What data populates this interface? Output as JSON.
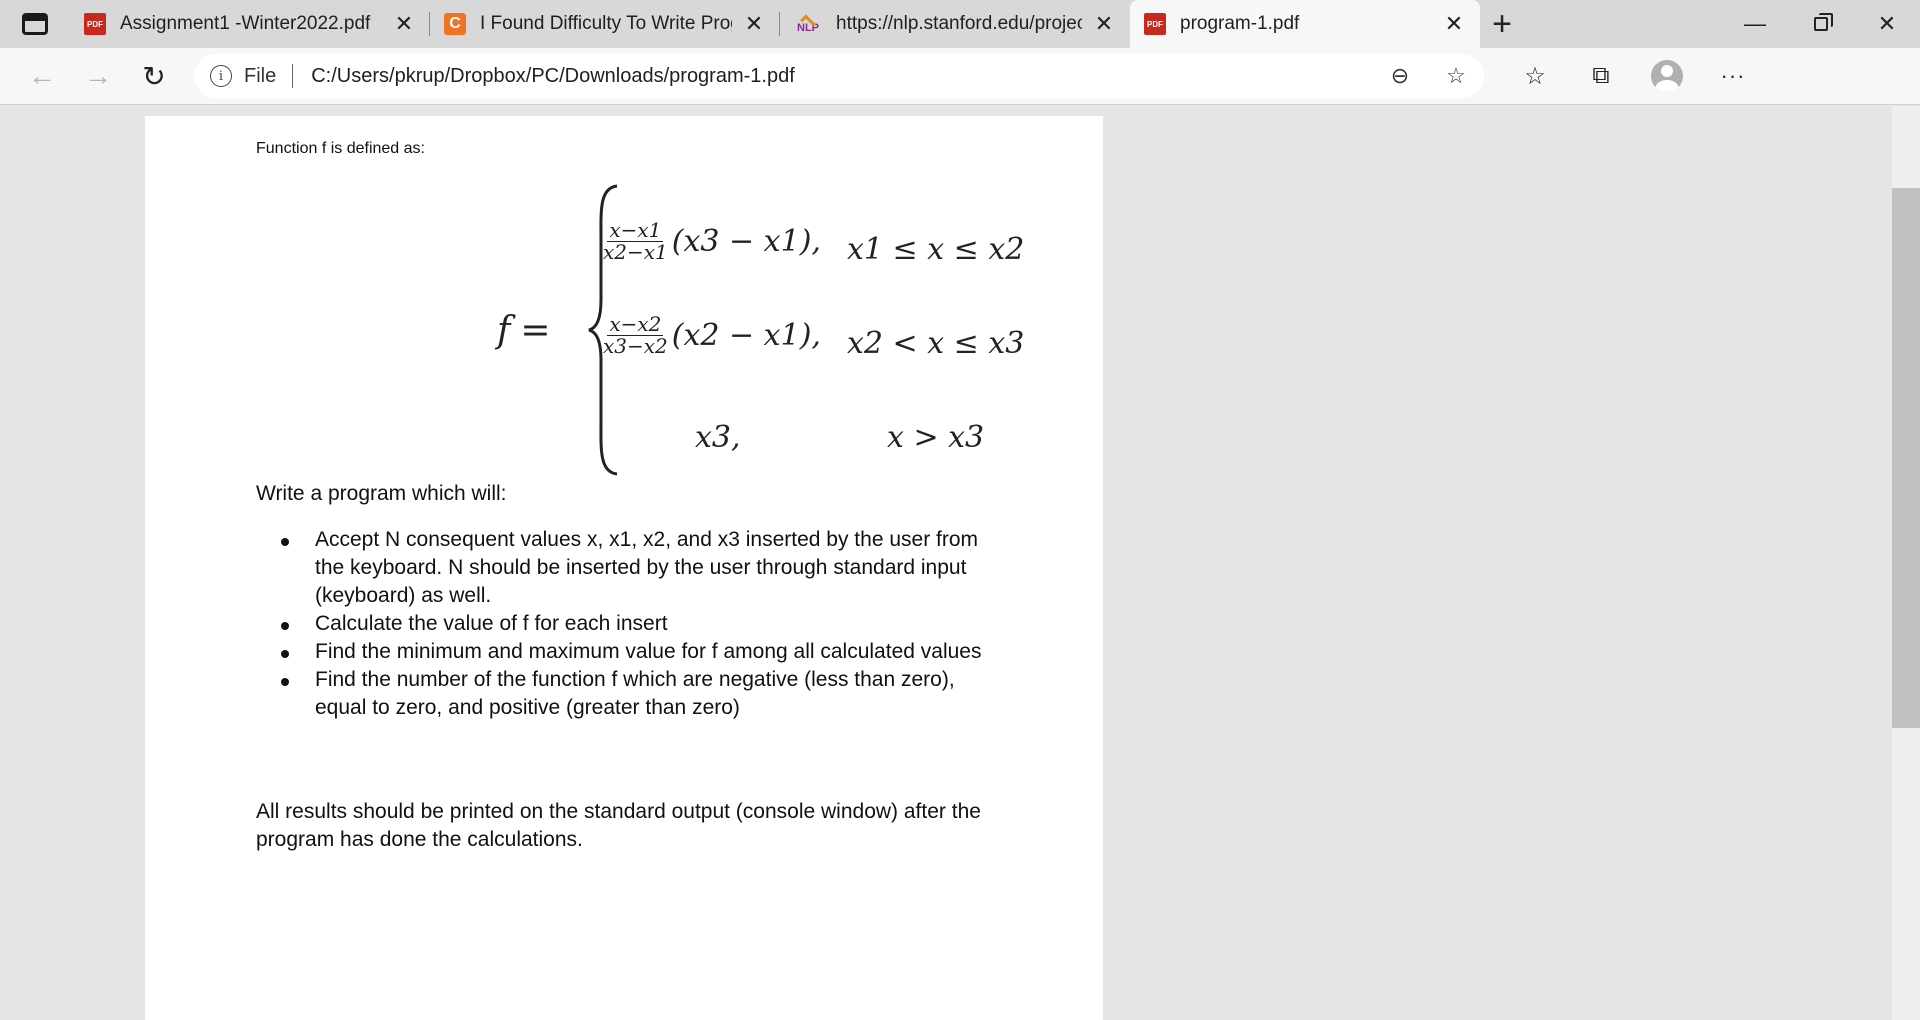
{
  "tabs": [
    {
      "title": "Assignment1 -Winter2022.pdf",
      "icon": "pdf-icon",
      "active": false
    },
    {
      "title": "I Found Difficulty To Write Progr",
      "icon": "chegg-c-icon",
      "active": false
    },
    {
      "title": "https://nlp.stanford.edu/projects",
      "icon": "nlp-icon",
      "active": false
    },
    {
      "title": "program-1.pdf",
      "icon": "pdf-icon",
      "active": true
    }
  ],
  "nlp_label": "NLP",
  "pdf_badge": "PDF",
  "chegg_badge": "C",
  "address": {
    "scheme_label": "File",
    "path": "C:/Users/pkrup/Dropbox/PC/Downloads/program-1.pdf"
  },
  "document": {
    "intro": "Function f is defined as:",
    "formula": {
      "lhs": "f",
      "cases": [
        {
          "num": "x−x1",
          "den": "x2−x1",
          "expr": "(x3 − x1),",
          "cond": "x1 ≤ x ≤ x2"
        },
        {
          "num": "x−x2",
          "den": "x3−x2",
          "expr": "(x2 − x1),",
          "cond": "x2 < x ≤ x3"
        },
        {
          "num": "",
          "den": "",
          "expr": "x3,",
          "cond": "x > x3"
        }
      ]
    },
    "lead": "Write a program which will:",
    "bullets": [
      "Accept N consequent values x, x1, x2, and x3 inserted by the user from the keyboard. N should be inserted by the user through standard input (keyboard) as well.",
      "Calculate the value of f for each insert",
      "Find the minimum and maximum value for f among all calculated values",
      "Find the number of the function f which are negative (less than zero), equal to zero, and positive (greater than zero)"
    ],
    "outro": "All results should be printed on the standard output (console window) after the program has done the calculations."
  }
}
